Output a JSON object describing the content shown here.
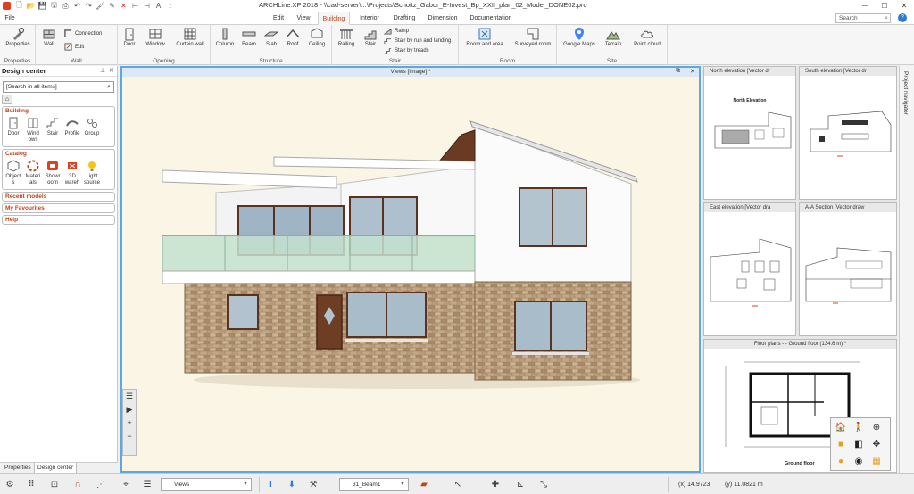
{
  "titlebar": {
    "title": "ARCHLine.XP 2018 - \\\\cad-server\\...\\Projects\\Schoitz_Gabor_E-Invest_Bp_XXII_plan_02_Model_DONE02.pro",
    "minimize": "─",
    "maximize": "☐",
    "close": "✕"
  },
  "tabs": {
    "file": "File",
    "items": [
      "Edit",
      "View",
      "Building",
      "Interior",
      "Drafting",
      "Dimension",
      "Documentation"
    ],
    "active": "Building",
    "search_placeholder": "Search",
    "help": "?"
  },
  "ribbon": {
    "groups": {
      "properties": "Properties",
      "wall": "Wall",
      "opening": "Opening",
      "structure": "Structure",
      "stair": "Stair",
      "room": "Room",
      "site": "Site"
    },
    "buttons": {
      "properties": "Properties",
      "wall": "Wall",
      "connection": "Connection",
      "edit": "Edit",
      "door": "Door",
      "window": "Window",
      "curtain_wall": "Curtain wall",
      "column": "Column",
      "beam": "Beam",
      "slab": "Slab",
      "roof": "Roof",
      "ceiling": "Ceiling",
      "railing": "Railing",
      "stair": "Stair",
      "ramp": "Ramp",
      "stair_run_landing": "Stair by run and landing",
      "stair_treads": "Stair by treads",
      "room_area": "Room and area",
      "surveyed_room": "Surveyed room",
      "google_maps": "Google Maps",
      "terrain": "Terrain",
      "point_cloud": "Point cloud"
    }
  },
  "design_center": {
    "title": "Design center",
    "search_placeholder": "[Search in all items]",
    "building": {
      "title": "Building",
      "items": [
        "Door",
        "Wind\nows",
        "Stair",
        "Profile",
        "Group"
      ]
    },
    "catalog": {
      "title": "Catalog",
      "items": [
        "Object\ns",
        "Materi\nals",
        "Showr\noom",
        "3D\nwareh",
        "Light\nsource"
      ]
    },
    "rows": [
      "Recent models",
      "My Favourites",
      "Help"
    ]
  },
  "bottom_tabs": {
    "properties": "Properties",
    "design_center": "Design center"
  },
  "viewport": {
    "title": "Views [Image] *"
  },
  "thumbnails": {
    "north": {
      "title": "North elevation [Vector dr",
      "caption": "North Elevation"
    },
    "south": {
      "title": "South elevation [Vector dr"
    },
    "east": {
      "title": "East elevation [Vector dra"
    },
    "section": {
      "title": "A-A Section [Vector draw"
    },
    "floor": {
      "title": "Floor plans - - Ground floor (134.6 m) *",
      "caption": "Ground floor"
    }
  },
  "project_navigator": "Project navigator",
  "statusbar": {
    "views_combo": "Views",
    "layer_combo": "31_Beam1",
    "coord_x": "(x) 14.9723",
    "coord_y": "(y) 11.0821 m"
  },
  "colors": {
    "accent": "#c0441a",
    "viewport_border": "#5aa9e6",
    "viewport_bg": "#fbf5e6"
  }
}
